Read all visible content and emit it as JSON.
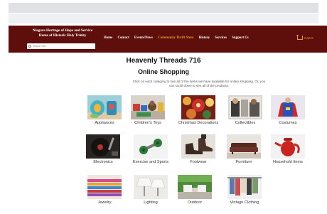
{
  "header": {
    "brand_line1": "Niagara Heritage of Hope and Service",
    "brand_line2": "Home of Historic Holy Trinity",
    "search_placeholder": "Search Site",
    "nav": [
      "Home",
      "Contact",
      "Events/News",
      "Community Thrift Store",
      "History",
      "Services",
      "Support Us"
    ],
    "active_nav": "Community Thrift Store",
    "cart_label": "Cart 0"
  },
  "main": {
    "title": "Heavenly Threads 716",
    "subtitle": "Online Shopping",
    "intro": "Click on each category to see all of the items we have available for online shopping.  Or, you can scroll down to see all of the products."
  },
  "categories": [
    {
      "label": "Appliances",
      "icon": "appliances-image"
    },
    {
      "label": "Children's Toys",
      "icon": "toys-image"
    },
    {
      "label": "Christmas Decorations",
      "icon": "christmas-image"
    },
    {
      "label": "Collectibles",
      "icon": "collectibles-image"
    },
    {
      "label": "Costumes",
      "icon": "costumes-image"
    },
    {
      "label": "Electronics",
      "icon": "electronics-image"
    },
    {
      "label": "Exercise and Sports",
      "icon": "exercise-image"
    },
    {
      "label": "Footwear",
      "icon": "footwear-image"
    },
    {
      "label": "Furniture",
      "icon": "furniture-image"
    },
    {
      "label": "Household Items",
      "icon": "household-image"
    },
    {
      "label": "Jewelry",
      "icon": "jewelry-image"
    },
    {
      "label": "Lighting",
      "icon": "lighting-image"
    },
    {
      "label": "Outdoor",
      "icon": "outdoor-image"
    },
    {
      "label": "Vintage Clothing",
      "icon": "vintage-clothing-image"
    }
  ],
  "colors": {
    "header_bg": "#5e0f0c",
    "accent": "#e89b27"
  }
}
